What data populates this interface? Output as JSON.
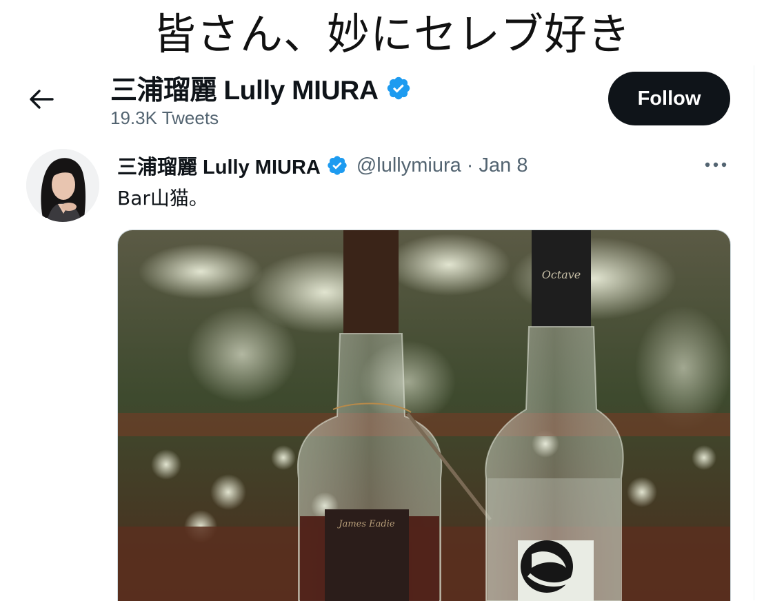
{
  "caption": "皆さん、妙にセレブ好き",
  "header": {
    "profile_name": "三浦瑠麗 Lully MIURA",
    "tweet_count": "19.3K Tweets",
    "follow_label": "Follow"
  },
  "tweet": {
    "author_name": "三浦瑠麗 Lully MIURA",
    "handle_and_date": "@lullymiura · Jan 8",
    "text": "Bar山猫。"
  },
  "media": {
    "bottle_left_label": "James Eadie",
    "bottle_right_label": "Octave"
  },
  "colors": {
    "verified_badge": "#1d9bf0",
    "follow_button_bg": "#0f1419",
    "secondary_text": "#536471"
  },
  "icons": {
    "back": "back-arrow-icon",
    "verified": "verified-badge-icon",
    "more": "more-icon"
  }
}
